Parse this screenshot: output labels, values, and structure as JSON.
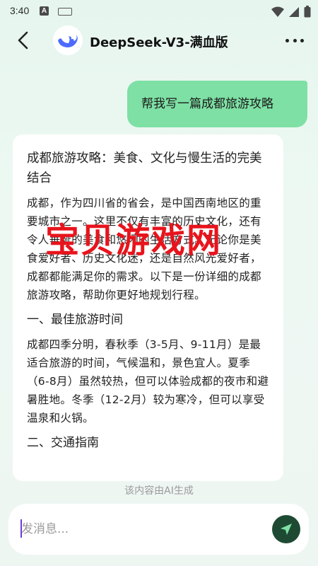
{
  "status_bar": {
    "time": "3:40",
    "notification_icon": "A-icon",
    "keyboard_icon": "keyboard-icon",
    "signal_icons": [
      "wifi-icon",
      "cell-signal-icon",
      "battery-icon"
    ]
  },
  "header": {
    "title": "DeepSeek-V3-满血版",
    "back_icon": "back-arrow-icon",
    "more_icon": "more-icon"
  },
  "user_message": "帮我写一篇成都旅游攻略",
  "ai_message": {
    "title": "成都旅游攻略：美食、文化与慢生活的完美结合",
    "intro": "成都，作为四川省的省会，是中国西南地区的重要城市之一。这里不仅有丰富的历史文化，还有令人垂涎的美食和悠闲的生活方式。无论你是美食爱好者、历史文化迷，还是自然风光爱好者，成都都能满足你的需求。以下是一份详细的成都旅游攻略，帮助你更好地规划行程。",
    "section1_heading": "一、最佳旅游时间",
    "section1_text": "成都四季分明，春秋季（3-5月、9-11月）是最适合旅游的时间，气候温和，景色宜人。夏季（6-8月）虽然较热，但可以体验成都的夜市和避暑胜地。冬季（12-2月）较为寒冷，但可以享受温泉和火锅。",
    "section2_heading": "二、交通指南"
  },
  "watermark": "宝贝游戏网",
  "ai_notice": "该内容由AI生成",
  "input": {
    "placeholder": "发消息...",
    "value": ""
  },
  "colors": {
    "user_bubble": "#7ee0a4",
    "send_button": "#1e4a33",
    "watermark": "#e8141c",
    "background": "#e6f6ee"
  }
}
